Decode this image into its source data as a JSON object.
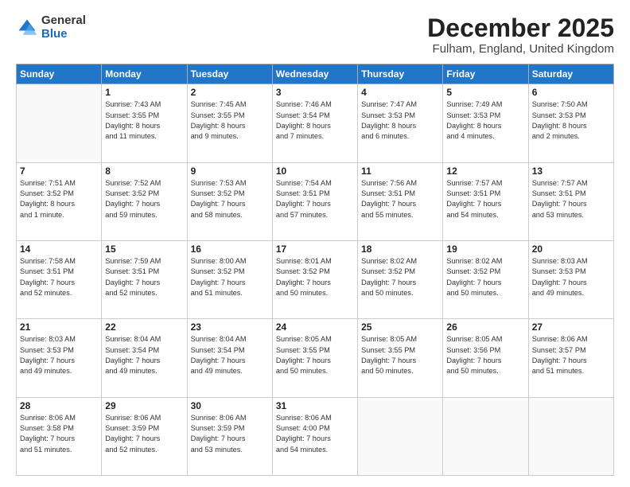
{
  "logo": {
    "general": "General",
    "blue": "Blue"
  },
  "header": {
    "month": "December 2025",
    "location": "Fulham, England, United Kingdom"
  },
  "weekdays": [
    "Sunday",
    "Monday",
    "Tuesday",
    "Wednesday",
    "Thursday",
    "Friday",
    "Saturday"
  ],
  "weeks": [
    [
      {
        "day": "",
        "info": ""
      },
      {
        "day": "1",
        "info": "Sunrise: 7:43 AM\nSunset: 3:55 PM\nDaylight: 8 hours\nand 11 minutes."
      },
      {
        "day": "2",
        "info": "Sunrise: 7:45 AM\nSunset: 3:55 PM\nDaylight: 8 hours\nand 9 minutes."
      },
      {
        "day": "3",
        "info": "Sunrise: 7:46 AM\nSunset: 3:54 PM\nDaylight: 8 hours\nand 7 minutes."
      },
      {
        "day": "4",
        "info": "Sunrise: 7:47 AM\nSunset: 3:53 PM\nDaylight: 8 hours\nand 6 minutes."
      },
      {
        "day": "5",
        "info": "Sunrise: 7:49 AM\nSunset: 3:53 PM\nDaylight: 8 hours\nand 4 minutes."
      },
      {
        "day": "6",
        "info": "Sunrise: 7:50 AM\nSunset: 3:53 PM\nDaylight: 8 hours\nand 2 minutes."
      }
    ],
    [
      {
        "day": "7",
        "info": "Sunrise: 7:51 AM\nSunset: 3:52 PM\nDaylight: 8 hours\nand 1 minute."
      },
      {
        "day": "8",
        "info": "Sunrise: 7:52 AM\nSunset: 3:52 PM\nDaylight: 7 hours\nand 59 minutes."
      },
      {
        "day": "9",
        "info": "Sunrise: 7:53 AM\nSunset: 3:52 PM\nDaylight: 7 hours\nand 58 minutes."
      },
      {
        "day": "10",
        "info": "Sunrise: 7:54 AM\nSunset: 3:51 PM\nDaylight: 7 hours\nand 57 minutes."
      },
      {
        "day": "11",
        "info": "Sunrise: 7:56 AM\nSunset: 3:51 PM\nDaylight: 7 hours\nand 55 minutes."
      },
      {
        "day": "12",
        "info": "Sunrise: 7:57 AM\nSunset: 3:51 PM\nDaylight: 7 hours\nand 54 minutes."
      },
      {
        "day": "13",
        "info": "Sunrise: 7:57 AM\nSunset: 3:51 PM\nDaylight: 7 hours\nand 53 minutes."
      }
    ],
    [
      {
        "day": "14",
        "info": "Sunrise: 7:58 AM\nSunset: 3:51 PM\nDaylight: 7 hours\nand 52 minutes."
      },
      {
        "day": "15",
        "info": "Sunrise: 7:59 AM\nSunset: 3:51 PM\nDaylight: 7 hours\nand 52 minutes."
      },
      {
        "day": "16",
        "info": "Sunrise: 8:00 AM\nSunset: 3:52 PM\nDaylight: 7 hours\nand 51 minutes."
      },
      {
        "day": "17",
        "info": "Sunrise: 8:01 AM\nSunset: 3:52 PM\nDaylight: 7 hours\nand 50 minutes."
      },
      {
        "day": "18",
        "info": "Sunrise: 8:02 AM\nSunset: 3:52 PM\nDaylight: 7 hours\nand 50 minutes."
      },
      {
        "day": "19",
        "info": "Sunrise: 8:02 AM\nSunset: 3:52 PM\nDaylight: 7 hours\nand 50 minutes."
      },
      {
        "day": "20",
        "info": "Sunrise: 8:03 AM\nSunset: 3:53 PM\nDaylight: 7 hours\nand 49 minutes."
      }
    ],
    [
      {
        "day": "21",
        "info": "Sunrise: 8:03 AM\nSunset: 3:53 PM\nDaylight: 7 hours\nand 49 minutes."
      },
      {
        "day": "22",
        "info": "Sunrise: 8:04 AM\nSunset: 3:54 PM\nDaylight: 7 hours\nand 49 minutes."
      },
      {
        "day": "23",
        "info": "Sunrise: 8:04 AM\nSunset: 3:54 PM\nDaylight: 7 hours\nand 49 minutes."
      },
      {
        "day": "24",
        "info": "Sunrise: 8:05 AM\nSunset: 3:55 PM\nDaylight: 7 hours\nand 50 minutes."
      },
      {
        "day": "25",
        "info": "Sunrise: 8:05 AM\nSunset: 3:55 PM\nDaylight: 7 hours\nand 50 minutes."
      },
      {
        "day": "26",
        "info": "Sunrise: 8:05 AM\nSunset: 3:56 PM\nDaylight: 7 hours\nand 50 minutes."
      },
      {
        "day": "27",
        "info": "Sunrise: 8:06 AM\nSunset: 3:57 PM\nDaylight: 7 hours\nand 51 minutes."
      }
    ],
    [
      {
        "day": "28",
        "info": "Sunrise: 8:06 AM\nSunset: 3:58 PM\nDaylight: 7 hours\nand 51 minutes."
      },
      {
        "day": "29",
        "info": "Sunrise: 8:06 AM\nSunset: 3:59 PM\nDaylight: 7 hours\nand 52 minutes."
      },
      {
        "day": "30",
        "info": "Sunrise: 8:06 AM\nSunset: 3:59 PM\nDaylight: 7 hours\nand 53 minutes."
      },
      {
        "day": "31",
        "info": "Sunrise: 8:06 AM\nSunset: 4:00 PM\nDaylight: 7 hours\nand 54 minutes."
      },
      {
        "day": "",
        "info": ""
      },
      {
        "day": "",
        "info": ""
      },
      {
        "day": "",
        "info": ""
      }
    ]
  ]
}
